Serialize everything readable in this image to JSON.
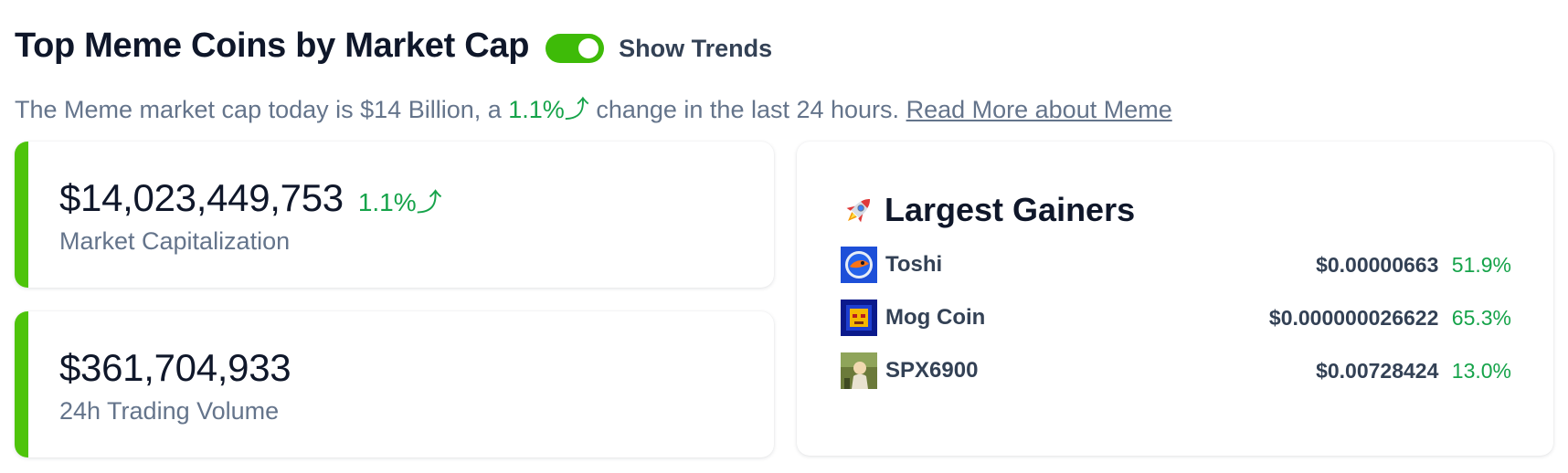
{
  "header": {
    "title": "Top Meme Coins by Market Cap",
    "toggle_label": "Show Trends",
    "toggle_on": true
  },
  "summary": {
    "prefix": "The Meme market cap today is $14 Billion, a",
    "change": "1.1%⤴",
    "suffix": "change in the last 24 hours.",
    "link": "Read More about Meme"
  },
  "market_cap": {
    "value": "$14,023,449,753",
    "change": "1.1%⤴",
    "label": "Market Capitalization"
  },
  "volume": {
    "value": "$361,704,933",
    "label": "24h Trading Volume"
  },
  "gainers": {
    "title": "Largest Gainers",
    "icon": "rocket-icon",
    "items": [
      {
        "name": "Toshi",
        "price": "$0.00000663",
        "change": "51.9%",
        "icon": "toshi-coin-icon"
      },
      {
        "name": "Mog Coin",
        "price": "$0.000000026622",
        "change": "65.3%",
        "icon": "mog-coin-icon"
      },
      {
        "name": "SPX6900",
        "price": "$0.00728424",
        "change": "13.0%",
        "icon": "spx6900-coin-icon"
      }
    ]
  },
  "colors": {
    "accent_green": "#4ec40a",
    "positive": "#16a34a",
    "toggle": "#3ebb08",
    "muted_text": "#64748b"
  }
}
